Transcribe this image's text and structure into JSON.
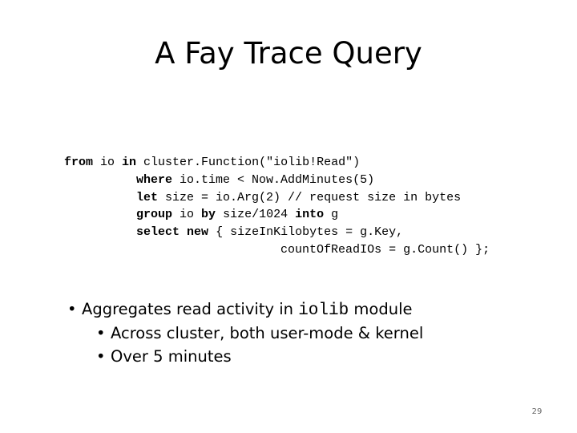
{
  "slide": {
    "title": "A Fay Trace Query",
    "code_lines": [
      {
        "indent": "",
        "parts": [
          [
            "kw",
            "from"
          ],
          [
            "t",
            " io "
          ],
          [
            "kw",
            "in"
          ],
          [
            "t",
            " cluster.Function(\"iolib!Read\")"
          ]
        ]
      },
      {
        "indent": "          ",
        "parts": [
          [
            "kw",
            "where"
          ],
          [
            "t",
            " io.time < Now.AddMinutes(5)"
          ]
        ]
      },
      {
        "indent": "          ",
        "parts": [
          [
            "kw",
            "let"
          ],
          [
            "t",
            " size = io.Arg(2) // request size in bytes"
          ]
        ]
      },
      {
        "indent": "          ",
        "parts": [
          [
            "kw",
            "group"
          ],
          [
            "t",
            " io "
          ],
          [
            "kw",
            "by"
          ],
          [
            "t",
            " size/1024 "
          ],
          [
            "kw",
            "into"
          ],
          [
            "t",
            " g"
          ]
        ]
      },
      {
        "indent": "          ",
        "parts": [
          [
            "kw",
            "select"
          ],
          [
            "t",
            " "
          ],
          [
            "kw",
            "new"
          ],
          [
            "t",
            " { sizeInKilobytes = g.Key,"
          ]
        ]
      },
      {
        "indent": "                              ",
        "parts": [
          [
            "t",
            "countOfReadIOs = g.Count() };"
          ]
        ]
      }
    ],
    "bullets": {
      "main": {
        "bullet": "•",
        "text_before": "Aggregates read activity in ",
        "code": "iolib",
        "text_after": " module"
      },
      "sub": [
        {
          "bullet": "•",
          "text": "Across cluster, both user-mode & kernel"
        },
        {
          "bullet": "•",
          "text": "Over 5 minutes"
        }
      ]
    },
    "page_number": "29"
  }
}
